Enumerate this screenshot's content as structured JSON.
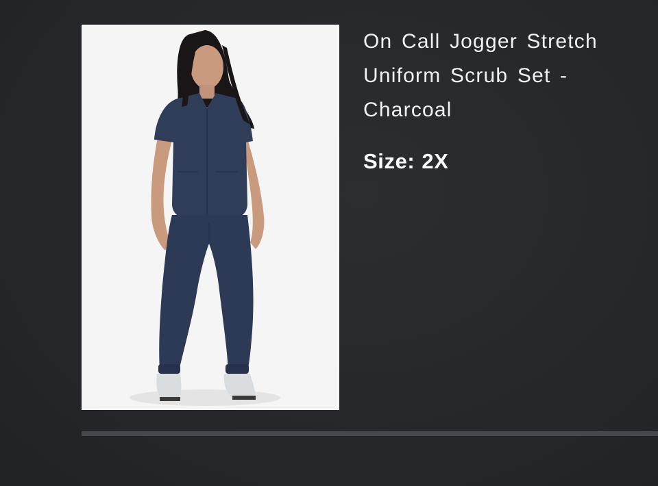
{
  "product": {
    "title": "On Call Jogger Stretch Uniform Scrub Set - Charcoal",
    "size_label": "Size:",
    "size_value": "2X",
    "image": {
      "icon": "product-photo",
      "garment_color": "#2c3a55",
      "background_color": "#f4f4f4"
    }
  },
  "colors": {
    "page_background": "#26282c",
    "text": "#ffffff",
    "divider": "#44474d"
  }
}
